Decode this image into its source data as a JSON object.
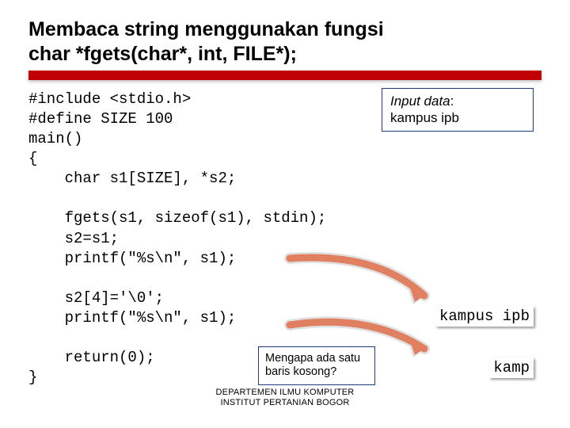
{
  "title_l1": "Membaca string menggunakan fungsi",
  "title_l2": "char *fgets(char*, int, FILE*);",
  "code": {
    "l1": "#include <stdio.h>",
    "l2": "#define SIZE 100",
    "l3": "main()",
    "l4": "{",
    "l5": "    char s1[SIZE], *s2;",
    "l6": "",
    "l7": "    fgets(s1, sizeof(s1), stdin);",
    "l8": "    s2=s1;",
    "l9": "    printf(\"%s\\n\", s1);",
    "l10": "",
    "l11": "    s2[4]='\\0';",
    "l12": "    printf(\"%s\\n\", s1);",
    "l13": "",
    "l14": "    return(0);",
    "l15": "}"
  },
  "input": {
    "label": "Input data",
    "value": "kampus ipb"
  },
  "output1": "kampus ipb",
  "output2": "kamp",
  "callout": "Mengapa ada satu baris kosong?",
  "footer": {
    "l1": "DEPARTEMEN ILMU KOMPUTER",
    "l2": "INSTITUT PERTANIAN BOGOR"
  }
}
